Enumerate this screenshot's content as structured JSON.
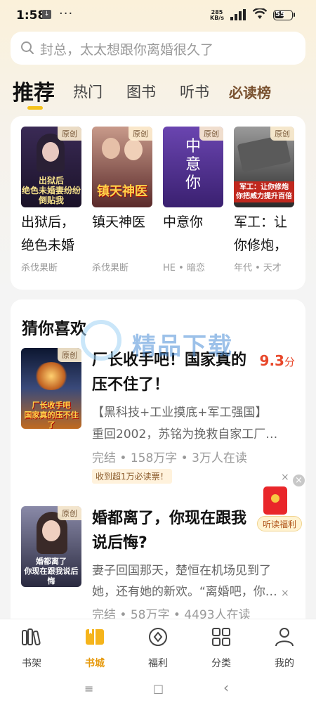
{
  "status": {
    "time": "1:58",
    "net_speed_value": "285",
    "net_speed_unit": "KB/s",
    "battery": "55",
    "menu_dots": "···"
  },
  "search": {
    "placeholder": "封总，太太想跟你离婚很久了"
  },
  "tabs": [
    {
      "label": "推荐",
      "active": true
    },
    {
      "label": "热门"
    },
    {
      "label": "图书"
    },
    {
      "label": "听书"
    },
    {
      "label": "必读榜"
    }
  ],
  "recommend": {
    "badge": "原创",
    "books": [
      {
        "title": "出狱后，绝色未婚",
        "meta": "杀伐果断",
        "cover_text": "出狱后\n绝色未婚妻纷纷倒贴我",
        "cover_color": "#2a1e3a"
      },
      {
        "title": "镇天神医",
        "meta": "杀伐果断",
        "cover_text": "镇天神医",
        "cover_color": "#5a2a2a"
      },
      {
        "title": "中意你",
        "meta": "HE • 暗恋",
        "cover_text": "中意你",
        "cover_color": "#4b2f8a"
      },
      {
        "title": "军工：让你修炮，",
        "meta": "年代 • 天才",
        "cover_text": "军工：让你修炮\n你把威力提升百倍",
        "cover_color": "#3a3a3a"
      }
    ]
  },
  "guess": {
    "title": "猜你喜欢",
    "items": [
      {
        "title": "厂长收手吧！国家真的压不住了！",
        "score": "9.3",
        "score_unit": "分",
        "tags": "【黑科技+工业摸底+军工强国】",
        "desc": "重回2002，苏铭为挽救自家工厂…",
        "stats": "完结 • 158万字 • 3万人在读",
        "badge": "收到超1万必读票！",
        "cover_text": "厂长收手吧\n国家真的压不住了",
        "cover_color": "#1b2a4a"
      },
      {
        "title": "婚都离了，你现在跟我说后悔?",
        "desc1": "妻子回国那天，楚恒在机场见到了",
        "desc2": "她，还有她的新欢。“离婚吧，你…",
        "stats": "完结 • 58万字 • 4493人在读",
        "cover_text": "婚都离了\n你现在跟我说后悔",
        "cover_color": "#3b3550"
      }
    ]
  },
  "float_widget": {
    "label": "听读福利",
    "close": "×"
  },
  "watermark": {
    "text": "精品下载"
  },
  "bottom_nav": [
    {
      "label": "书架",
      "icon": "bookshelf-icon"
    },
    {
      "label": "书城",
      "icon": "bookstore-icon",
      "active": true
    },
    {
      "label": "福利",
      "icon": "welfare-icon"
    },
    {
      "label": "分类",
      "icon": "category-icon"
    },
    {
      "label": "我的",
      "icon": "profile-icon"
    }
  ],
  "system_nav": {
    "menu": "≡",
    "home": "□",
    "back": "‹"
  },
  "colors": {
    "accent": "#f5c21b",
    "score": "#e8472a",
    "active_nav": "#e69a0e"
  }
}
